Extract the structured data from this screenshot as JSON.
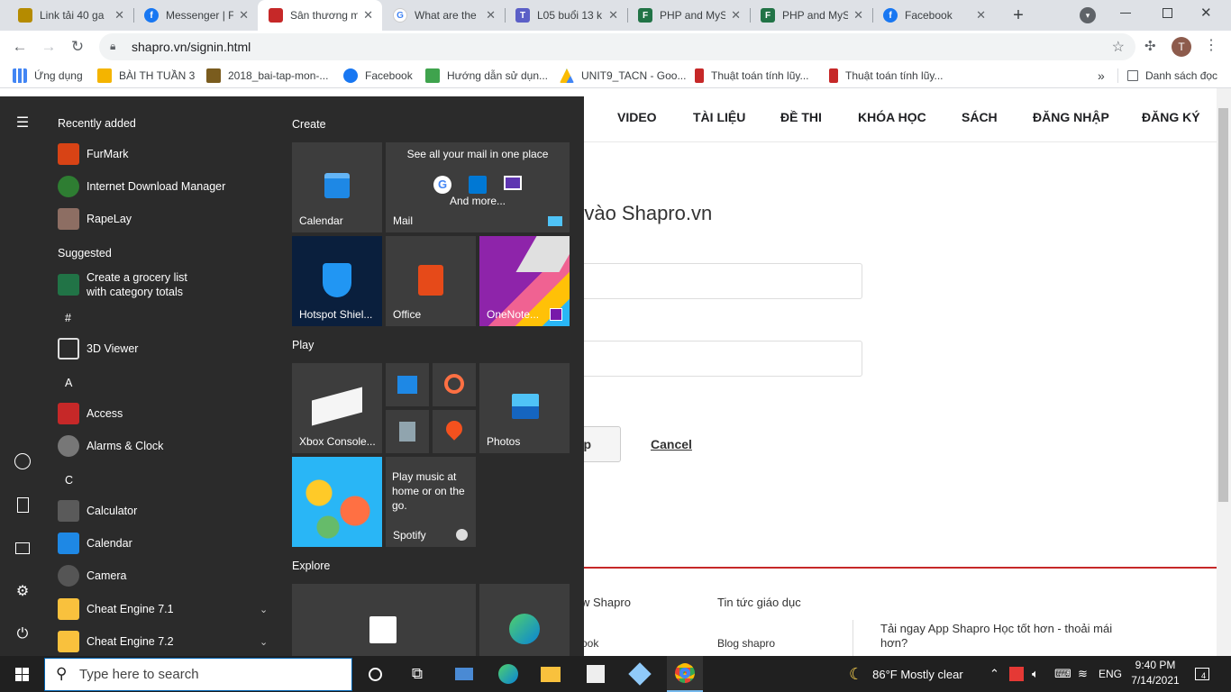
{
  "tabs": [
    {
      "title": "Link tải 40 ga",
      "color": "#b58b00"
    },
    {
      "title": "Messenger | F",
      "color": "#1877f2"
    },
    {
      "title": "Sân thương m",
      "color": "#c62828"
    },
    {
      "title": "What are the",
      "color": "#4285f4"
    },
    {
      "title": "L05 buổi 13 k",
      "color": "#5b5fc7"
    },
    {
      "title": "PHP and MySQ",
      "color": "#217346"
    },
    {
      "title": "PHP and MySQ",
      "color": "#217346"
    },
    {
      "title": "Facebook",
      "color": "#1877f2"
    }
  ],
  "toolbar": {
    "url": "shapro.vn/signin.html",
    "avatar": "T"
  },
  "bookmarks": [
    {
      "label": "Ứng dụng",
      "color": "#4285f4"
    },
    {
      "label": "BÀI TH TUẦN 3",
      "color": "#f4b400"
    },
    {
      "label": "2018_bai-tap-mon-...",
      "color": "#7a5c1e"
    },
    {
      "label": "Facebook",
      "color": "#1877f2"
    },
    {
      "label": "Hướng dẫn sử dụn...",
      "color": "#3fa34d"
    },
    {
      "label": "UNIT9_TACN - Goo...",
      "color": "#fbbc04"
    },
    {
      "label": "Thuật toán tính lũy...",
      "color": "#c62828"
    },
    {
      "label": "Thuật toán tính lũy...",
      "color": "#c62828"
    }
  ],
  "bookmarks_more": "»",
  "reading_list": "Danh sách đọc",
  "site": {
    "nav": [
      "VIDEO",
      "TÀI LIỆU",
      "ĐỀ THI",
      "KHÓA HỌC",
      "SÁCH",
      "ĐĂNG NHẬP",
      "ĐĂNG KÝ"
    ],
    "heading": "p vào Shapro.vn",
    "submit_partial": "p",
    "cancel": "Cancel",
    "footer_col1": "w Shapro",
    "footer_col1_item": "ook",
    "footer_col2": "Tin tức giáo dục",
    "footer_col2_item": "Blog shapro",
    "footer_col3": "Tải ngay App Shapro Học tốt hơn - thoải mái hơn?"
  },
  "start": {
    "recently_added": "Recently added",
    "recent": [
      {
        "label": "FurMark",
        "color": "#d84315"
      },
      {
        "label": "Internet Download Manager",
        "color": "#2e7d32"
      },
      {
        "label": "RapeLay",
        "color": "#8d6e63"
      }
    ],
    "suggested": "Suggested",
    "suggested_item": {
      "line1": "Create a grocery list",
      "line2": "with category totals"
    },
    "letters": [
      "#",
      "A",
      "C"
    ],
    "apps": [
      {
        "label": "3D Viewer",
        "color": "#555555"
      },
      {
        "label": "Access",
        "color": "#c62828"
      },
      {
        "label": "Alarms & Clock",
        "color": "#777777"
      },
      {
        "label": "Calculator",
        "color": "#5a5a5a"
      },
      {
        "label": "Calendar",
        "color": "#1e88e5"
      },
      {
        "label": "Camera",
        "color": "#555555"
      },
      {
        "label": "Cheat Engine 7.1",
        "color": "#f9c13d"
      },
      {
        "label": "Cheat Engine 7.2",
        "color": "#f9c13d"
      }
    ],
    "groups": {
      "create": "Create",
      "play": "Play",
      "explore": "Explore"
    },
    "tiles": {
      "calendar": "Calendar",
      "mail": "Mail",
      "mail_caption": "See all your mail in one place",
      "mail_more": "And more...",
      "hotspot": "Hotspot Shiel...",
      "office": "Office",
      "onenote": "OneNote...",
      "xbox": "Xbox Console...",
      "photos": "Photos",
      "spotify_text": "Play music at home or on the go.",
      "spotify": "Spotify"
    }
  },
  "taskbar": {
    "search_placeholder": "Type here to search",
    "weather": "86°F  Mostly clear",
    "lang": "ENG",
    "time": "9:40 PM",
    "date": "7/14/2021",
    "notif_count": "4"
  }
}
